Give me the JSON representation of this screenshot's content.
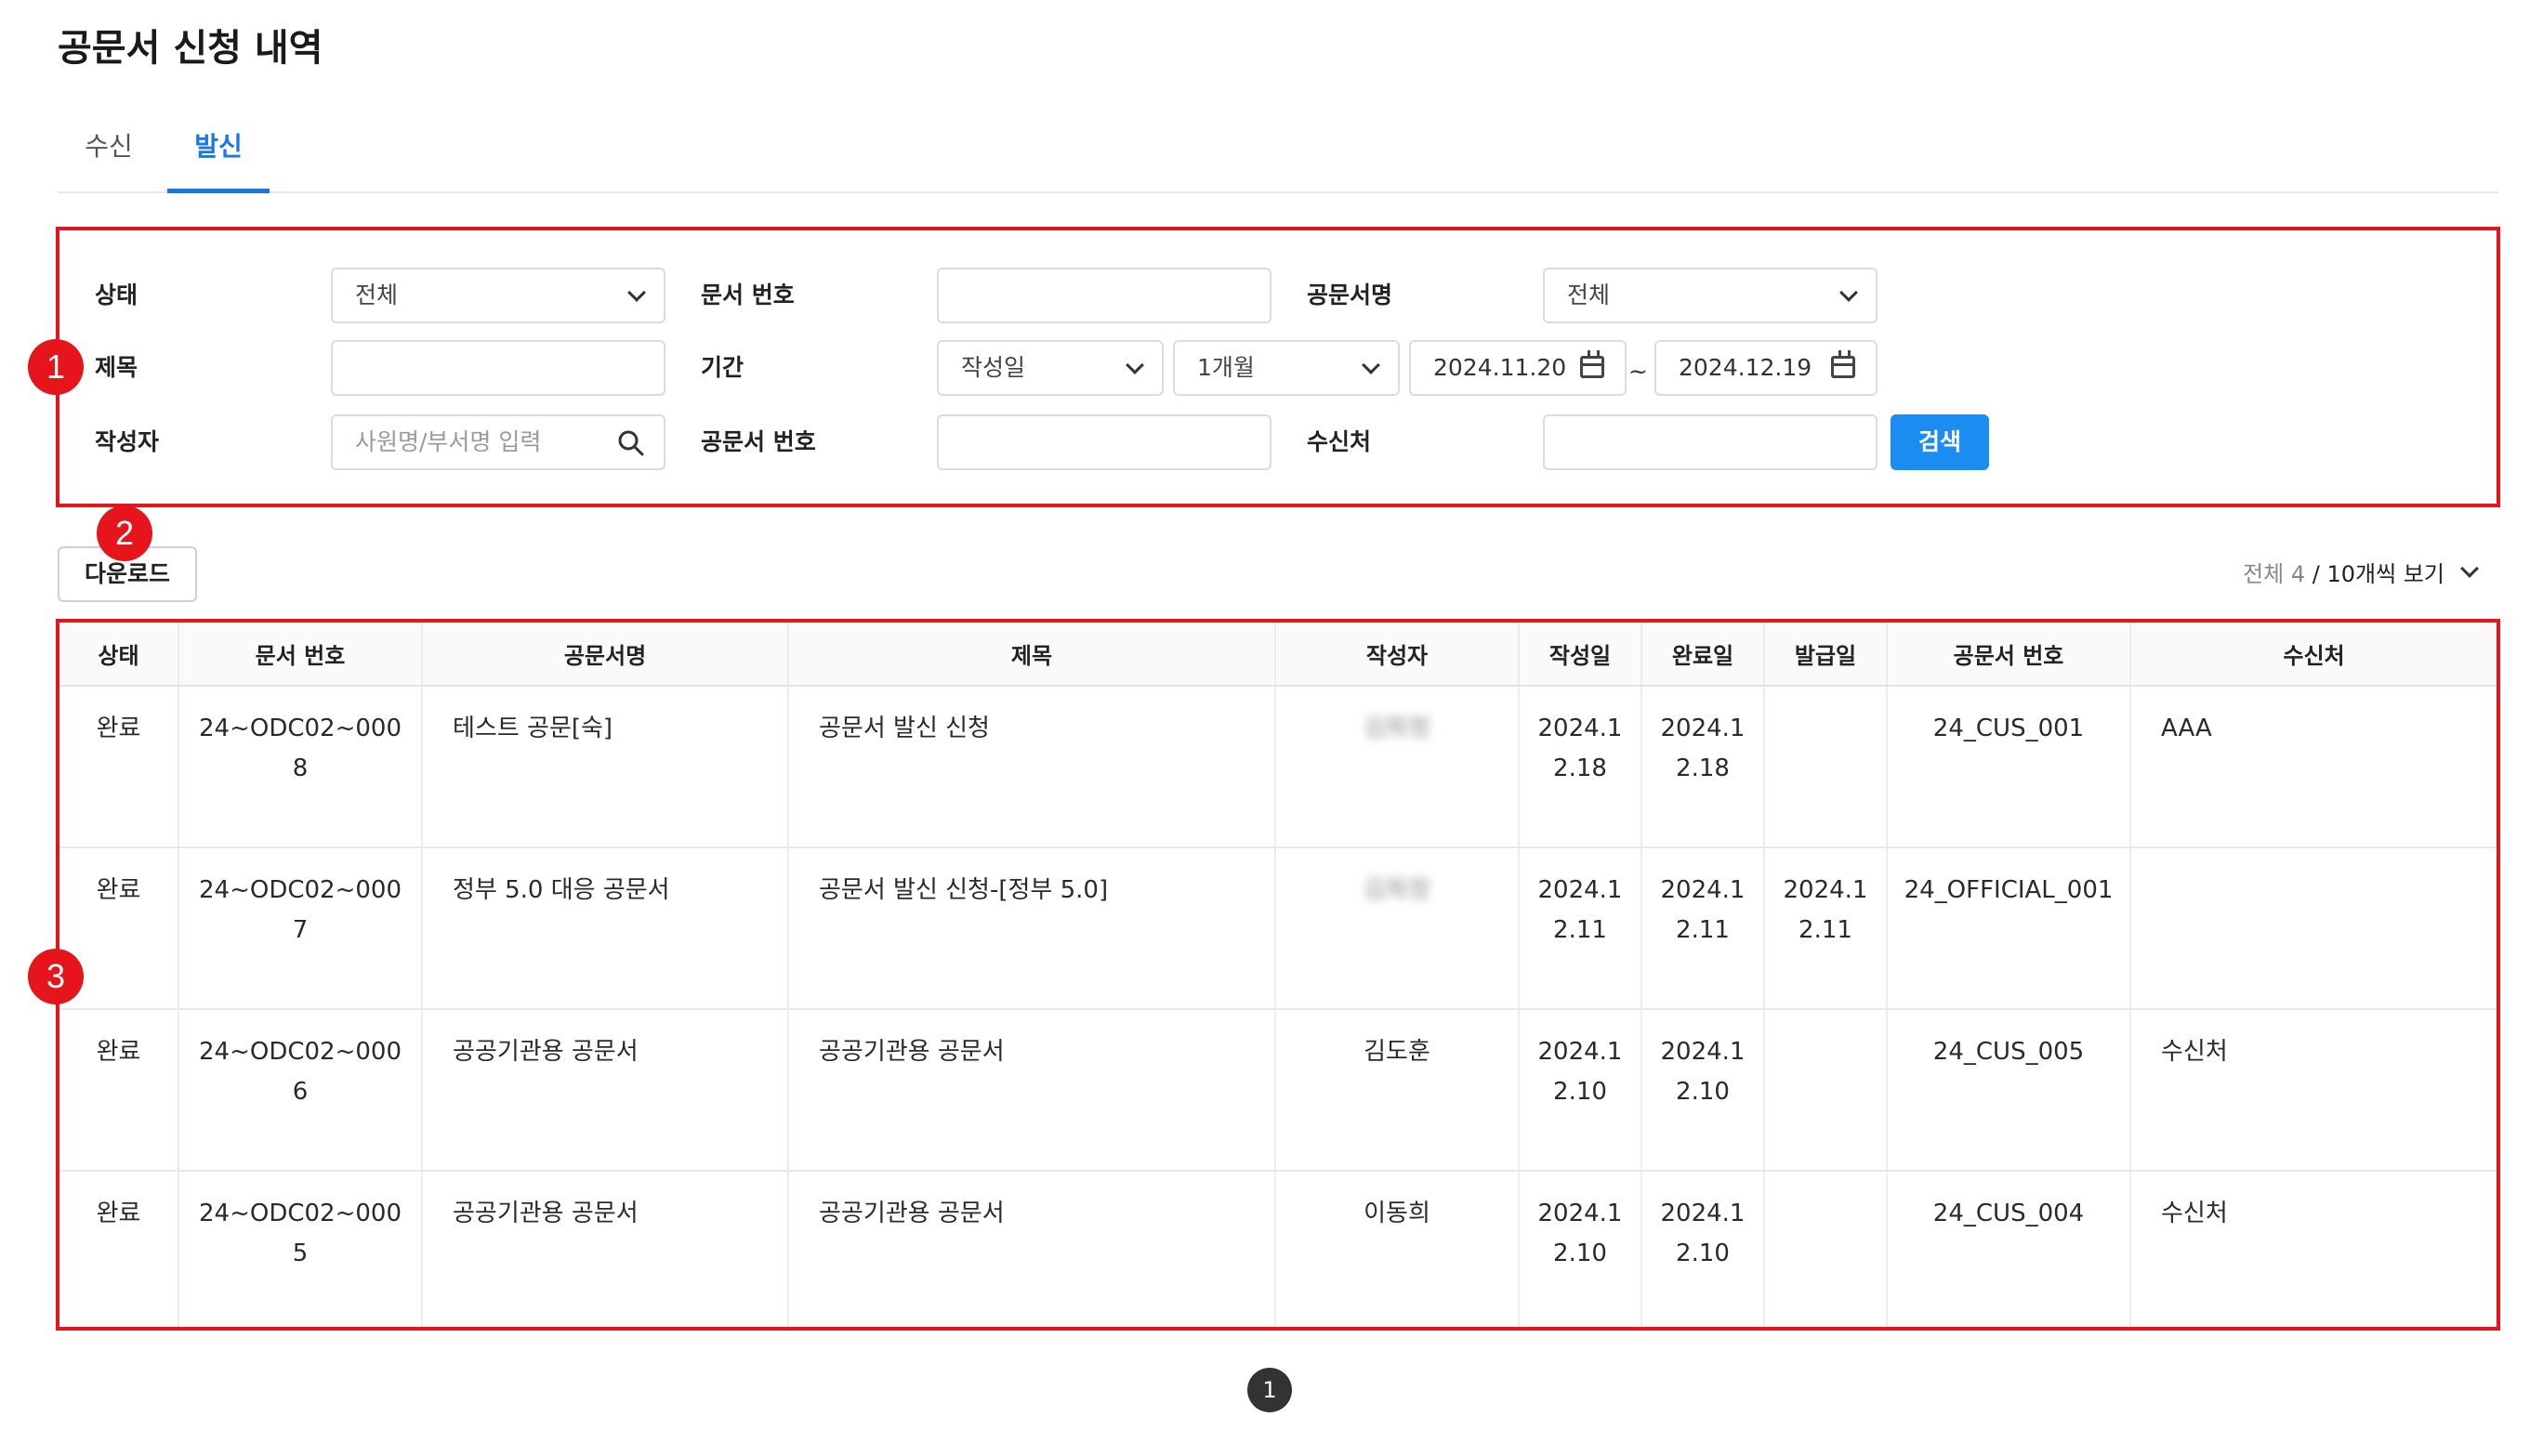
{
  "page_title": "공문서 신청 내역",
  "tabs": [
    {
      "label": "수신",
      "active": false
    },
    {
      "label": "발신",
      "active": true
    }
  ],
  "annotations": [
    "1",
    "2",
    "3"
  ],
  "filters": {
    "status_label": "상태",
    "status_value": "전체",
    "doc_no_label": "문서 번호",
    "doc_no_value": "",
    "doc_name_label": "공문서명",
    "doc_name_value": "전체",
    "subject_label": "제목",
    "subject_value": "",
    "period_label": "기간",
    "period_type": "작성일",
    "period_range": "1개월",
    "date_from": "2024.11.20",
    "date_separator": "~",
    "date_to": "2024.12.19",
    "author_label": "작성자",
    "author_placeholder": "사원명/부서명 입력",
    "official_no_label": "공문서 번호",
    "official_no_value": "",
    "recipient_label": "수신처",
    "recipient_value": "",
    "search_button": "검색"
  },
  "toolbar": {
    "download_button": "다운로드",
    "total_label": "전체 4",
    "separator": " / ",
    "per_page": "10개씩 보기"
  },
  "table": {
    "headers": [
      "상태",
      "문서 번호",
      "공문서명",
      "제목",
      "작성자",
      "작성일",
      "완료일",
      "발급일",
      "공문서 번호",
      "수신처"
    ],
    "rows": [
      {
        "status": "완료",
        "doc_no": "24~ODC02~0008",
        "doc_name": "테스트 공문[숙]",
        "subject": "공문서 발신 신청",
        "author": "김희정",
        "created": "2024.12.18",
        "completed": "2024.12.18",
        "issued": "",
        "official_no": "24_CUS_001",
        "recipient": "AAA"
      },
      {
        "status": "완료",
        "doc_no": "24~ODC02~0007",
        "doc_name": "정부 5.0 대응 공문서",
        "subject": "공문서 발신 신청-[정부 5.0]",
        "author": "김희정",
        "created": "2024.12.11",
        "completed": "2024.12.11",
        "issued": "2024.12.11",
        "official_no": "24_OFFICIAL_001",
        "recipient": ""
      },
      {
        "status": "완료",
        "doc_no": "24~ODC02~0006",
        "doc_name": "공공기관용 공문서",
        "subject": "공공기관용 공문서",
        "author": "김도훈",
        "created": "2024.12.10",
        "completed": "2024.12.10",
        "issued": "",
        "official_no": "24_CUS_005",
        "recipient": "수신처"
      },
      {
        "status": "완료",
        "doc_no": "24~ODC02~0005",
        "doc_name": "공공기관용 공문서",
        "subject": "공공기관용 공문서",
        "author": "이동희",
        "created": "2024.12.10",
        "completed": "2024.12.10",
        "issued": "",
        "official_no": "24_CUS_004",
        "recipient": "수신처"
      }
    ]
  },
  "pagination": {
    "current": "1"
  },
  "colors": {
    "accent": "#1677e5",
    "button_primary": "#1b8cf0",
    "annotation_red": "#e6141b"
  }
}
